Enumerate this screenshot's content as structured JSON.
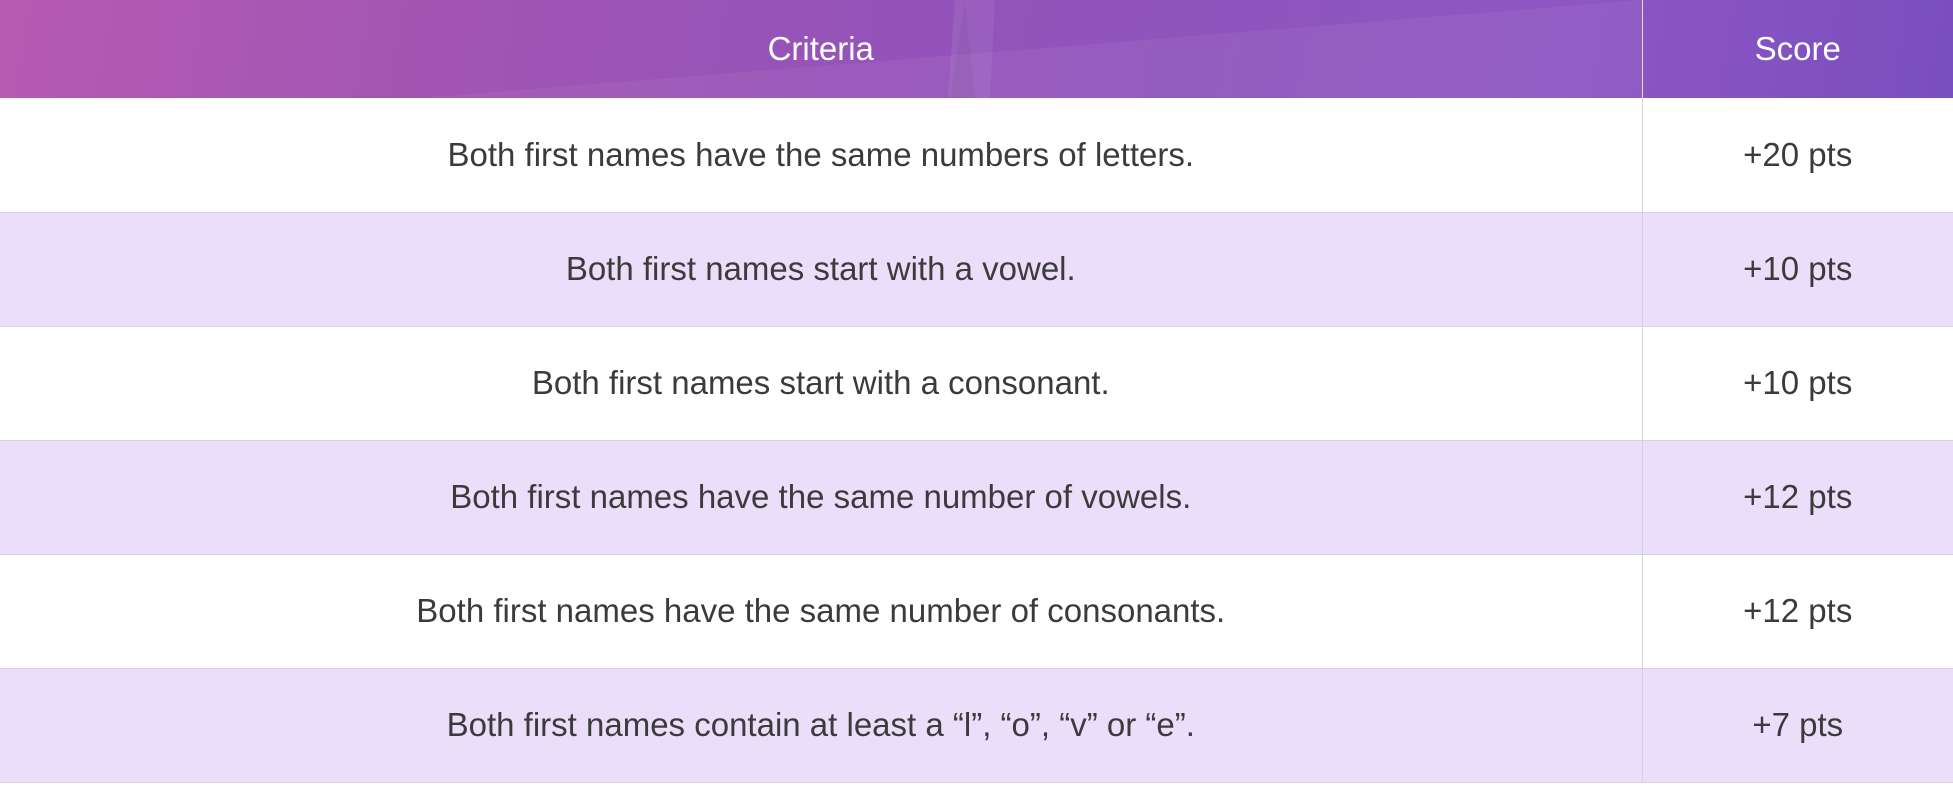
{
  "table": {
    "headers": {
      "criteria": "Criteria",
      "score": "Score"
    },
    "rows": [
      {
        "criteria": "Both first names have the same numbers of letters.",
        "score": "+20 pts"
      },
      {
        "criteria": "Both first names start with a vowel.",
        "score": "+10 pts"
      },
      {
        "criteria": "Both first names start with a consonant.",
        "score": "+10 pts"
      },
      {
        "criteria": "Both first names have the same number of vowels.",
        "score": "+12 pts"
      },
      {
        "criteria": "Both first names have the same number of consonants.",
        "score": "+12 pts"
      },
      {
        "criteria": "Both first names contain at least a “l”, “o”, “v” or “e”.",
        "score": "+7 pts"
      }
    ]
  },
  "colors": {
    "header_gradient_start": "#b65bb2",
    "header_gradient_end": "#7a4ec0",
    "row_alt": "#ebdefa",
    "row_base": "#ffffff",
    "text": "#3b3b3b"
  }
}
